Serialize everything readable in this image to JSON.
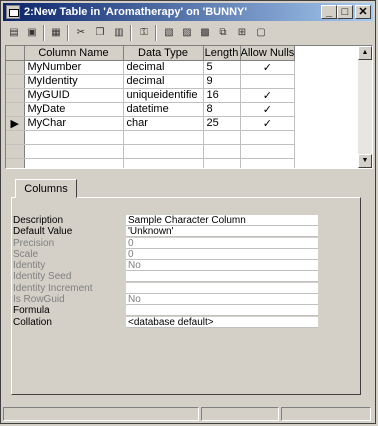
{
  "window": {
    "title": "2:New Table in 'Aromatherapy' on 'BUNNY'",
    "minimize_glyph": "_",
    "maximize_glyph": "□",
    "close_glyph": "✕"
  },
  "toolbar": {
    "icons": [
      "table-properties-icon",
      "save-icon",
      "new-table-icon",
      "cut-icon",
      "copy-icon",
      "paste-icon",
      "primary-key-icon",
      "insert-column-icon",
      "delete-column-icon",
      "manage-indexes-icon",
      "relationships-icon",
      "constraints-icon",
      "sql-script-icon"
    ]
  },
  "grid": {
    "headers": [
      "Column Name",
      "Data Type",
      "Length",
      "Allow Nulls"
    ],
    "rows": [
      {
        "name": "MyNumber",
        "type": "decimal",
        "length": "5",
        "nulls": "✓"
      },
      {
        "name": "MyIdentity",
        "type": "decimal",
        "length": "9",
        "nulls": ""
      },
      {
        "name": "MyGUID",
        "type": "uniqueidentifie",
        "length": "16",
        "nulls": "✓"
      },
      {
        "name": "MyDate",
        "type": "datetime",
        "length": "8",
        "nulls": "✓"
      },
      {
        "name": "MyChar",
        "type": "char",
        "length": "25",
        "nulls": "✓"
      }
    ],
    "current_row_marker": "▶"
  },
  "columns_tab": {
    "label": "Columns",
    "properties": [
      {
        "label": "Description",
        "value": "Sample Character Column",
        "dim": false
      },
      {
        "label": "Default Value",
        "value": "'Unknown'",
        "dim": false
      },
      {
        "label": "Precision",
        "value": "0",
        "dim": true
      },
      {
        "label": "Scale",
        "value": "0",
        "dim": true
      },
      {
        "label": "Identity",
        "value": "No",
        "dim": true
      },
      {
        "label": "Identity Seed",
        "value": "",
        "dim": true
      },
      {
        "label": "Identity Increment",
        "value": "",
        "dim": true
      },
      {
        "label": "Is RowGuid",
        "value": "No",
        "dim": true
      },
      {
        "label": "Formula",
        "value": "",
        "dim": false
      },
      {
        "label": "Collation",
        "value": "<database default>",
        "dim": false
      }
    ]
  }
}
